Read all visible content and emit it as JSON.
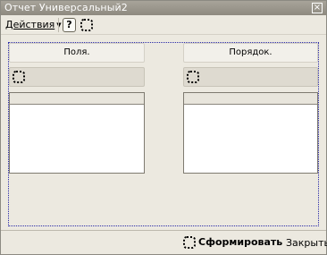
{
  "window": {
    "title": "Отчет Универсальный2",
    "close_glyph": "×"
  },
  "toolbar": {
    "actions_label": "Действия",
    "help_label": "?"
  },
  "left_panel": {
    "header": "Поля."
  },
  "right_panel": {
    "header": "Порядок."
  },
  "bottom": {
    "form_label": "Сформировать",
    "close_label": "Закрыть"
  },
  "icons": {
    "help": "help-icon",
    "placeholder": "placeholder-icon",
    "dropdown": "chevron-down-icon"
  },
  "colors": {
    "titlebar": "#9a968c",
    "window_bg": "#ece9e0",
    "grid_bg": "#ffffff",
    "focus_outline": "#2a2aa8"
  }
}
